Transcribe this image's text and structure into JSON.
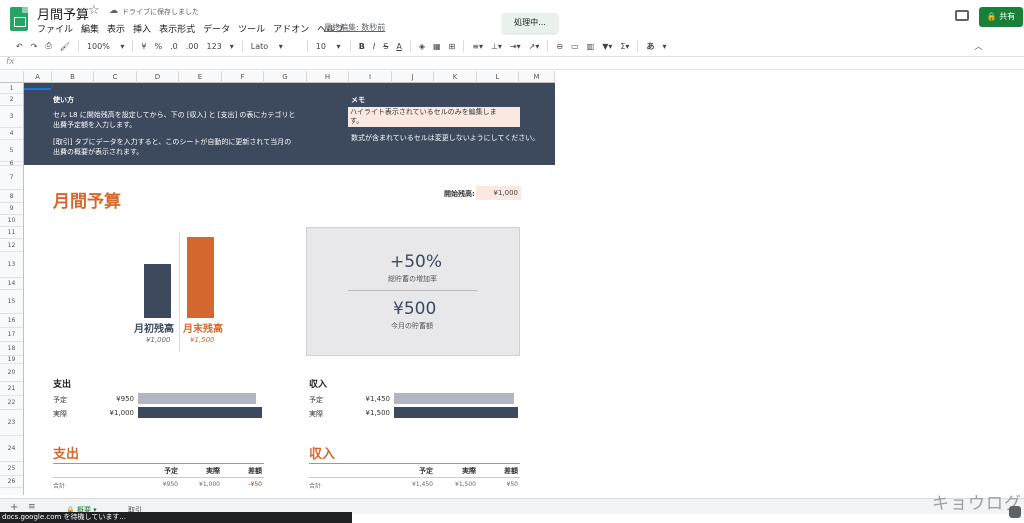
{
  "header": {
    "doc_title": "月間予算",
    "save_status": "ドライブに保存しました",
    "last_edit": "最終編集: 数秒前",
    "toast": "処理中...",
    "share_label": "共有",
    "menu": [
      "ファイル",
      "編集",
      "表示",
      "挿入",
      "表示形式",
      "データ",
      "ツール",
      "アドオン",
      "ヘルプ"
    ]
  },
  "toolbar": {
    "zoom": "100%",
    "currency": "¥",
    "percent": "%",
    "dec_less": ".0",
    "dec_more": ".00",
    "format": "123",
    "font": "Lato",
    "size": "10",
    "bold": "B",
    "italic": "I",
    "strike": "S",
    "text_color": "A",
    "input_tool": "あ"
  },
  "grid": {
    "columns": [
      "A",
      "B",
      "C",
      "D",
      "E",
      "F",
      "G",
      "H",
      "I",
      "J",
      "K",
      "L",
      "M"
    ],
    "rows": [
      "1",
      "2",
      "3",
      "4",
      "5",
      "6",
      "7",
      "8",
      "9",
      "10",
      "11",
      "12",
      "13",
      "14",
      "15",
      "16",
      "17",
      "18",
      "19",
      "20",
      "21",
      "22",
      "23",
      "24",
      "25",
      "26"
    ]
  },
  "banner": {
    "howto_title": "使い方",
    "howto_line1": "セル L8 に開始残高を設定してから、下の [収入] と [支出] の表にカテゴリと",
    "howto_line2": "出費予定額を入力します。",
    "howto_line3": "[取引] タブにデータを入力すると、このシートが自動的に更新されて当月の",
    "howto_line4": "出費の概要が表示されます。",
    "memo_title": "メモ",
    "memo_line1": "ハイライト表示されているセルのみを編集しま",
    "memo_line2": "す。",
    "memo_line3": "数式が含まれているセルは変更しないようにしてください。"
  },
  "summary": {
    "title": "月間予算",
    "start_balance_label": "開始残高:",
    "start_balance_value": "¥1,000",
    "bar_start_label": "月初残高",
    "bar_start_value": "¥1,000",
    "bar_end_label": "月末残高",
    "bar_end_value": "¥1,500",
    "increase_pct": "+50%",
    "increase_label": "総貯蓄の増加率",
    "savings": "¥500",
    "savings_label": "今月の貯蓄額"
  },
  "chart_data": {
    "type": "bar",
    "categories": [
      "月初残高",
      "月末残高"
    ],
    "values": [
      1000,
      1500
    ],
    "colors": [
      "#3d4a5e",
      "#d4692f"
    ]
  },
  "expense_summary": {
    "title": "支出",
    "plan_label": "予定",
    "plan_value": "¥950",
    "actual_label": "実際",
    "actual_value": "¥1,000",
    "plan_amount": 950,
    "actual_amount": 1000
  },
  "income_summary": {
    "title": "収入",
    "plan_label": "予定",
    "plan_value": "¥1,450",
    "actual_label": "実際",
    "actual_value": "¥1,500",
    "plan_amount": 1450,
    "actual_amount": 1500
  },
  "expense_table": {
    "title": "支出",
    "headers": [
      "予定",
      "実際",
      "差額"
    ],
    "total_label": "合計",
    "total": [
      "¥950",
      "¥1,000",
      "-¥50"
    ]
  },
  "income_table": {
    "title": "収入",
    "headers": [
      "予定",
      "実際",
      "差額"
    ],
    "total_label": "合計",
    "total": [
      "¥1,450",
      "¥1,500",
      "¥50"
    ]
  },
  "sheets": {
    "tab_summary": "概要",
    "tab_transactions": "取引"
  },
  "status": "docs.google.com を待機しています...",
  "watermark": "キョウログ"
}
